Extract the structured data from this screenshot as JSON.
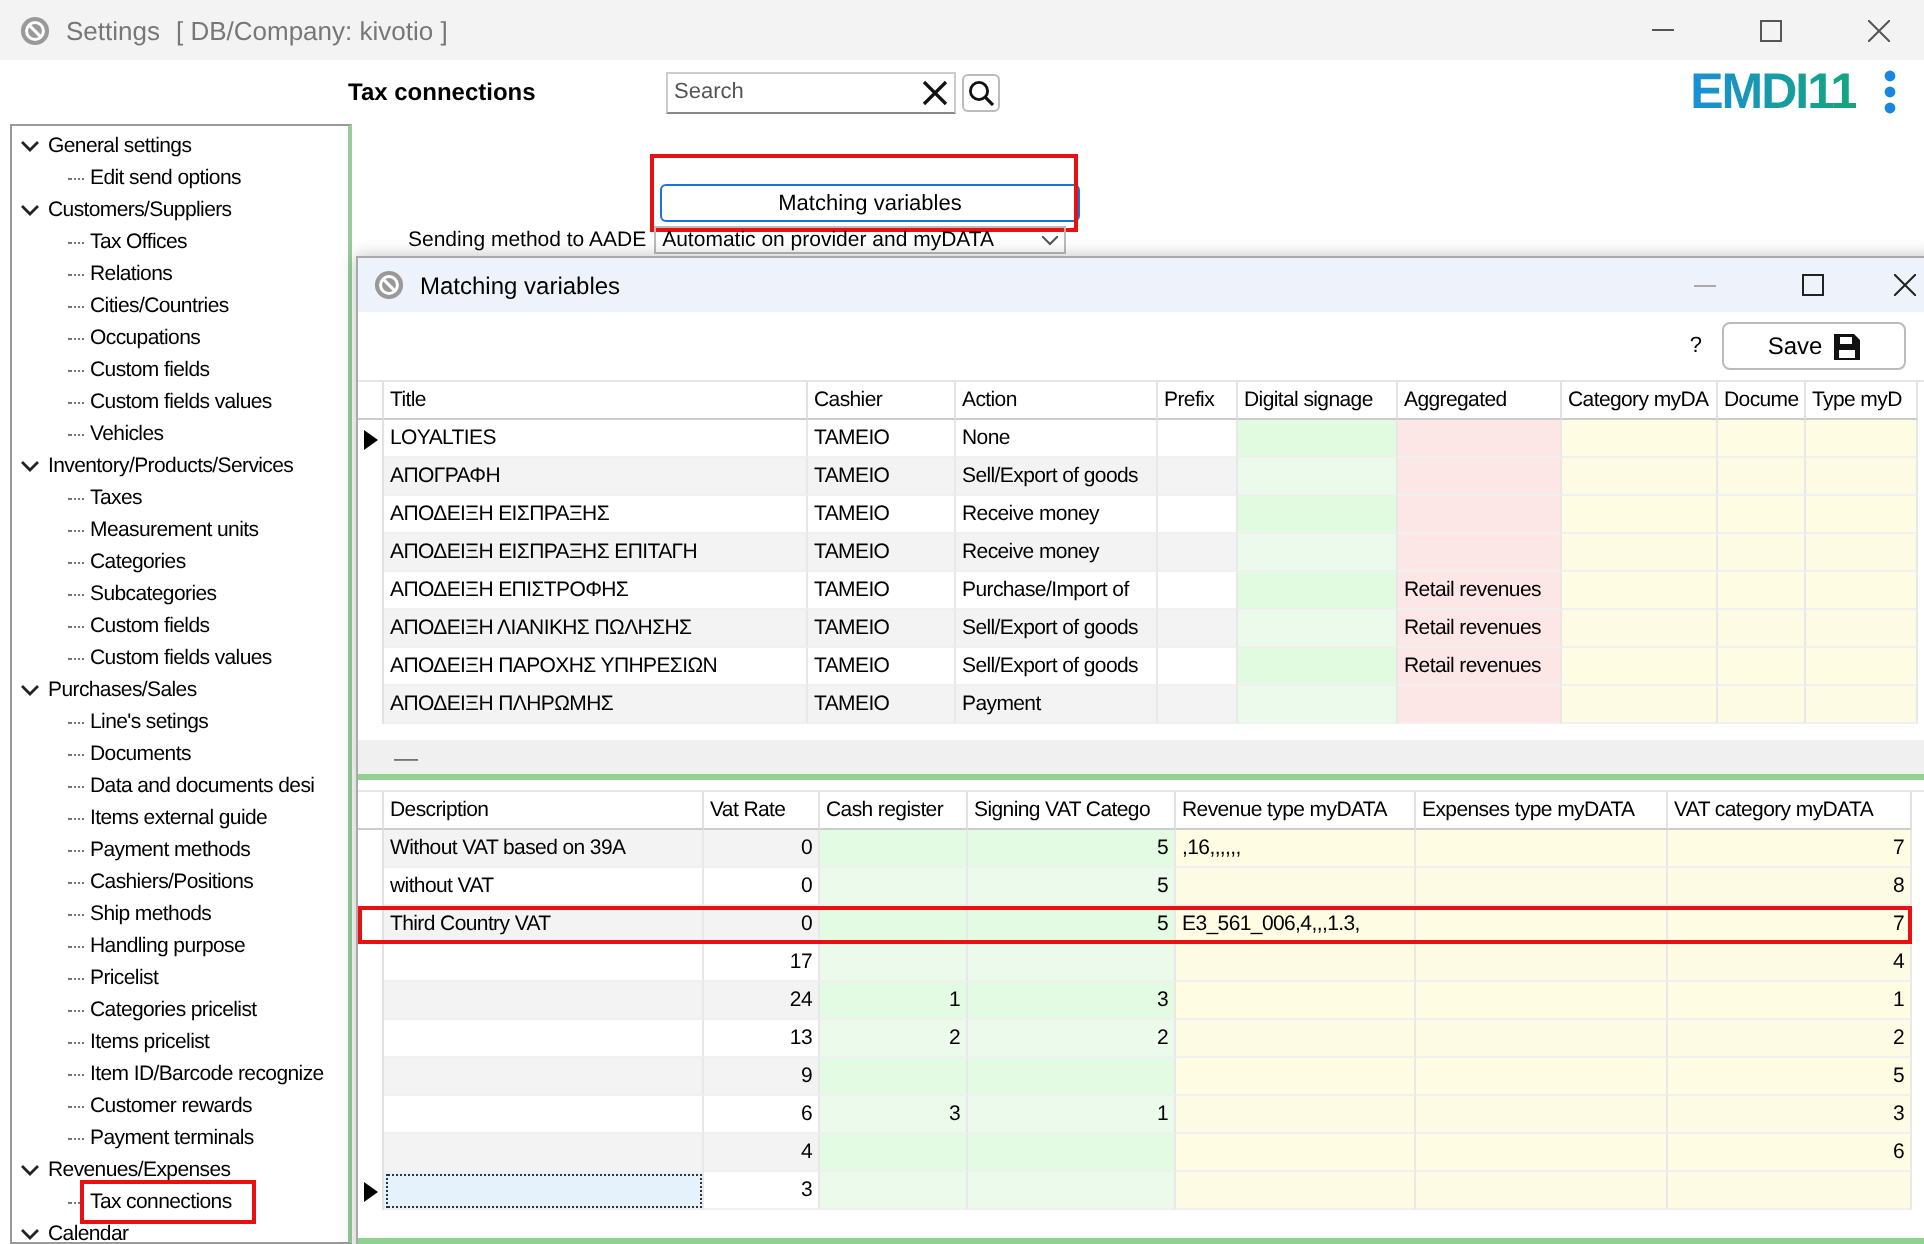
{
  "window": {
    "title": "Settings",
    "subtitle": "[ DB/Company: kivotio ]"
  },
  "header": {
    "section": "Tax connections",
    "search": {
      "placeholder": "Search"
    },
    "logo": "EMDI11"
  },
  "tree": [
    {
      "label": "General settings",
      "expanded": true,
      "children": [
        {
          "label": "Edit send options",
          "highlighted": false
        }
      ]
    },
    {
      "label": "Customers/Suppliers",
      "expanded": true,
      "children": [
        {
          "label": "Tax Offices",
          "highlighted": false
        },
        {
          "label": "Relations",
          "highlighted": false
        },
        {
          "label": "Cities/Countries",
          "highlighted": false
        },
        {
          "label": "Occupations",
          "highlighted": false
        },
        {
          "label": "Custom fields",
          "highlighted": false
        },
        {
          "label": "Custom fields values",
          "highlighted": false
        },
        {
          "label": "Vehicles",
          "highlighted": false
        }
      ]
    },
    {
      "label": "Inventory/Products/Services",
      "expanded": true,
      "children": [
        {
          "label": "Taxes",
          "highlighted": false
        },
        {
          "label": "Measurement units",
          "highlighted": false
        },
        {
          "label": "Categories",
          "highlighted": false
        },
        {
          "label": "Subcategories",
          "highlighted": false
        },
        {
          "label": "Custom fields",
          "highlighted": false
        },
        {
          "label": "Custom fields values",
          "highlighted": false
        }
      ]
    },
    {
      "label": "Purchases/Sales",
      "expanded": true,
      "children": [
        {
          "label": "Line's setings",
          "highlighted": false
        },
        {
          "label": "Documents",
          "highlighted": false
        },
        {
          "label": "Data and documents desi",
          "highlighted": false
        },
        {
          "label": "Items external guide",
          "highlighted": false
        },
        {
          "label": "Payment methods",
          "highlighted": false
        },
        {
          "label": "Cashiers/Positions",
          "highlighted": false
        },
        {
          "label": "Ship methods",
          "highlighted": false
        },
        {
          "label": "Handling purpose",
          "highlighted": false
        },
        {
          "label": "Pricelist",
          "highlighted": false
        },
        {
          "label": "Categories pricelist",
          "highlighted": false
        },
        {
          "label": "Items pricelist",
          "highlighted": false
        },
        {
          "label": "Item ID/Barcode recognize",
          "highlighted": false
        },
        {
          "label": "Customer rewards",
          "highlighted": false
        },
        {
          "label": "Payment terminals",
          "highlighted": false
        }
      ]
    },
    {
      "label": "Revenues/Expenses",
      "expanded": true,
      "children": [
        {
          "label": "Tax connections",
          "highlighted": true
        }
      ]
    },
    {
      "label": "Calendar",
      "expanded": true
    }
  ],
  "matching_button": {
    "label": "Matching variables",
    "highlighted": true
  },
  "sending_method": {
    "label": "Sending method to AADE",
    "value": "Automatic on provider and myDATA"
  },
  "dialog": {
    "title": "Matching variables",
    "help": "?",
    "save": "Save",
    "top_grid": {
      "columns": [
        {
          "label": "Title",
          "kind": "text"
        },
        {
          "label": "Cashier",
          "kind": "text"
        },
        {
          "label": "Action",
          "kind": "text"
        },
        {
          "label": "Prefix",
          "kind": "text"
        },
        {
          "label": "Digital signage",
          "kind": "signage"
        },
        {
          "label": "Aggregated",
          "kind": "aggregated"
        },
        {
          "label": "Category myDA",
          "kind": "mydata"
        },
        {
          "label": "Docume",
          "kind": "mydata"
        },
        {
          "label": "Type myD",
          "kind": "mydata"
        }
      ],
      "rows": [
        {
          "current": true,
          "highlighted": false,
          "cells": [
            "LOYALTIES",
            "ΤΑΜΕΙΟ",
            "None",
            null,
            null,
            null,
            null,
            null,
            null
          ]
        },
        {
          "current": false,
          "highlighted": false,
          "cells": [
            "ΑΠΟΓΡΑΦΗ",
            "ΤΑΜΕΙΟ",
            "Sell/Export of goods",
            null,
            null,
            null,
            null,
            null,
            null
          ]
        },
        {
          "current": false,
          "highlighted": false,
          "cells": [
            "ΑΠΟΔΕΙΞΗ ΕΙΣΠΡΑΞΗΣ",
            "ΤΑΜΕΙΟ",
            "Receive money",
            null,
            null,
            null,
            null,
            null,
            null
          ]
        },
        {
          "current": false,
          "highlighted": false,
          "cells": [
            "ΑΠΟΔΕΙΞΗ ΕΙΣΠΡΑΞΗΣ ΕΠΙΤΑΓΗ",
            "ΤΑΜΕΙΟ",
            "Receive money",
            null,
            null,
            null,
            null,
            null,
            null
          ]
        },
        {
          "current": false,
          "highlighted": false,
          "cells": [
            "ΑΠΟΔΕΙΞΗ ΕΠΙΣΤΡΟΦΗΣ",
            "ΤΑΜΕΙΟ",
            "Purchase/Import of",
            null,
            null,
            "Retail revenues",
            null,
            null,
            null
          ]
        },
        {
          "current": false,
          "highlighted": false,
          "cells": [
            "ΑΠΟΔΕΙΞΗ ΛΙΑΝΙΚΗΣ ΠΩΛΗΣΗΣ",
            "ΤΑΜΕΙΟ",
            "Sell/Export of goods",
            null,
            null,
            "Retail revenues",
            null,
            null,
            null
          ]
        },
        {
          "current": false,
          "highlighted": false,
          "cells": [
            "ΑΠΟΔΕΙΞΗ ΠΑΡΟΧΗΣ ΥΠΗΡΕΣΙΩΝ",
            "ΤΑΜΕΙΟ",
            "Sell/Export of goods",
            null,
            null,
            "Retail revenues",
            null,
            null,
            null
          ]
        },
        {
          "current": false,
          "highlighted": false,
          "cells": [
            "ΑΠΟΔΕΙΞΗ ΠΛΗΡΩΜΗΣ",
            "ΤΑΜΕΙΟ",
            "Payment",
            null,
            null,
            null,
            null,
            null,
            null
          ]
        }
      ]
    },
    "splitter": "—",
    "bottom_grid": {
      "columns": [
        {
          "label": "Description",
          "kind": "text"
        },
        {
          "label": "Vat Rate",
          "kind": "number"
        },
        {
          "label": "Cash register",
          "kind": "register"
        },
        {
          "label": "Signing VAT Catego",
          "kind": "register"
        },
        {
          "label": "Revenue type myDATA",
          "kind": "mydata"
        },
        {
          "label": "Expenses type myDATA",
          "kind": "mydata"
        },
        {
          "label": "VAT category myDATA",
          "kind": "code"
        }
      ],
      "rows": [
        {
          "current": false,
          "highlighted": false,
          "cells": [
            "Without VAT based on 39A",
            "0",
            null,
            "5",
            ",16,,,,,,",
            null,
            "7"
          ]
        },
        {
          "current": false,
          "highlighted": false,
          "cells": [
            "without VAT",
            "0",
            null,
            "5",
            null,
            null,
            "8"
          ]
        },
        {
          "current": false,
          "highlighted": true,
          "cells": [
            "Third Country VAT",
            "0",
            null,
            "5",
            "E3_561_006,4,,,1.3,",
            null,
            "7"
          ]
        },
        {
          "current": false,
          "highlighted": false,
          "cells": [
            null,
            "17",
            null,
            null,
            null,
            null,
            "4"
          ]
        },
        {
          "current": false,
          "highlighted": false,
          "cells": [
            null,
            "24",
            "1",
            "3",
            null,
            null,
            "1"
          ]
        },
        {
          "current": false,
          "highlighted": false,
          "cells": [
            null,
            "13",
            "2",
            "2",
            null,
            null,
            "2"
          ]
        },
        {
          "current": false,
          "highlighted": false,
          "cells": [
            null,
            "9",
            null,
            null,
            null,
            null,
            "5"
          ]
        },
        {
          "current": false,
          "highlighted": false,
          "cells": [
            null,
            "6",
            "3",
            "1",
            null,
            null,
            "3"
          ]
        },
        {
          "current": false,
          "highlighted": false,
          "cells": [
            null,
            "4",
            null,
            null,
            null,
            null,
            "6"
          ]
        },
        {
          "current": true,
          "highlighted": false,
          "cells": [
            null,
            "3",
            null,
            null,
            null,
            null,
            null
          ]
        }
      ]
    }
  }
}
